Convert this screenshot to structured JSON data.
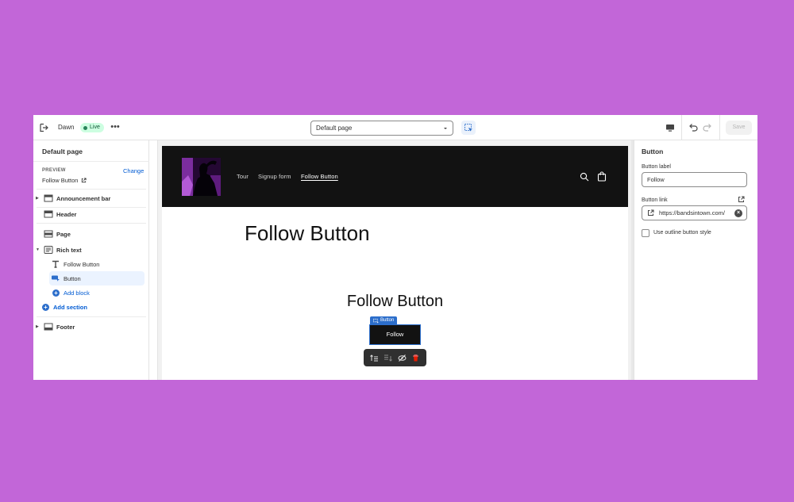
{
  "topbar": {
    "theme_name": "Dawn",
    "status": "Live",
    "page_select": "Default page",
    "save_label": "Save",
    "icons": [
      "exit-icon",
      "more-icon",
      "chevron-down-icon",
      "inspector-icon",
      "desktop-icon",
      "undo-icon",
      "redo-icon"
    ]
  },
  "left_panel": {
    "title": "Default page",
    "preview_label": "PREVIEW",
    "change_link": "Change",
    "preview_value": "Follow Button",
    "sections": {
      "announcement_bar": "Announcement bar",
      "header": "Header",
      "page": "Page",
      "rich_text": "Rich text",
      "footer": "Footer"
    },
    "blocks": {
      "follow_button": "Follow Button",
      "button": "Button",
      "add_block": "Add block"
    },
    "add_section": "Add section"
  },
  "preview": {
    "nav": [
      "Tour",
      "Signup form",
      "Follow Button"
    ],
    "active_nav": "Follow Button",
    "page_heading": "Follow Button",
    "rich_heading": "Follow Button",
    "block_tag": "Button",
    "button_label": "Follow"
  },
  "right_panel": {
    "title": "Button",
    "label_field_label": "Button label",
    "label_field_value": "Follow",
    "link_field_label": "Button link",
    "link_field_value": "https://bandsintown.com/",
    "outline_checkbox_label": "Use outline button style",
    "outline_checked": false
  },
  "colors": {
    "background": "#c266d8",
    "accent": "#2c6ecb",
    "live_badge": "#cdfee1",
    "store_header": "#121212"
  }
}
